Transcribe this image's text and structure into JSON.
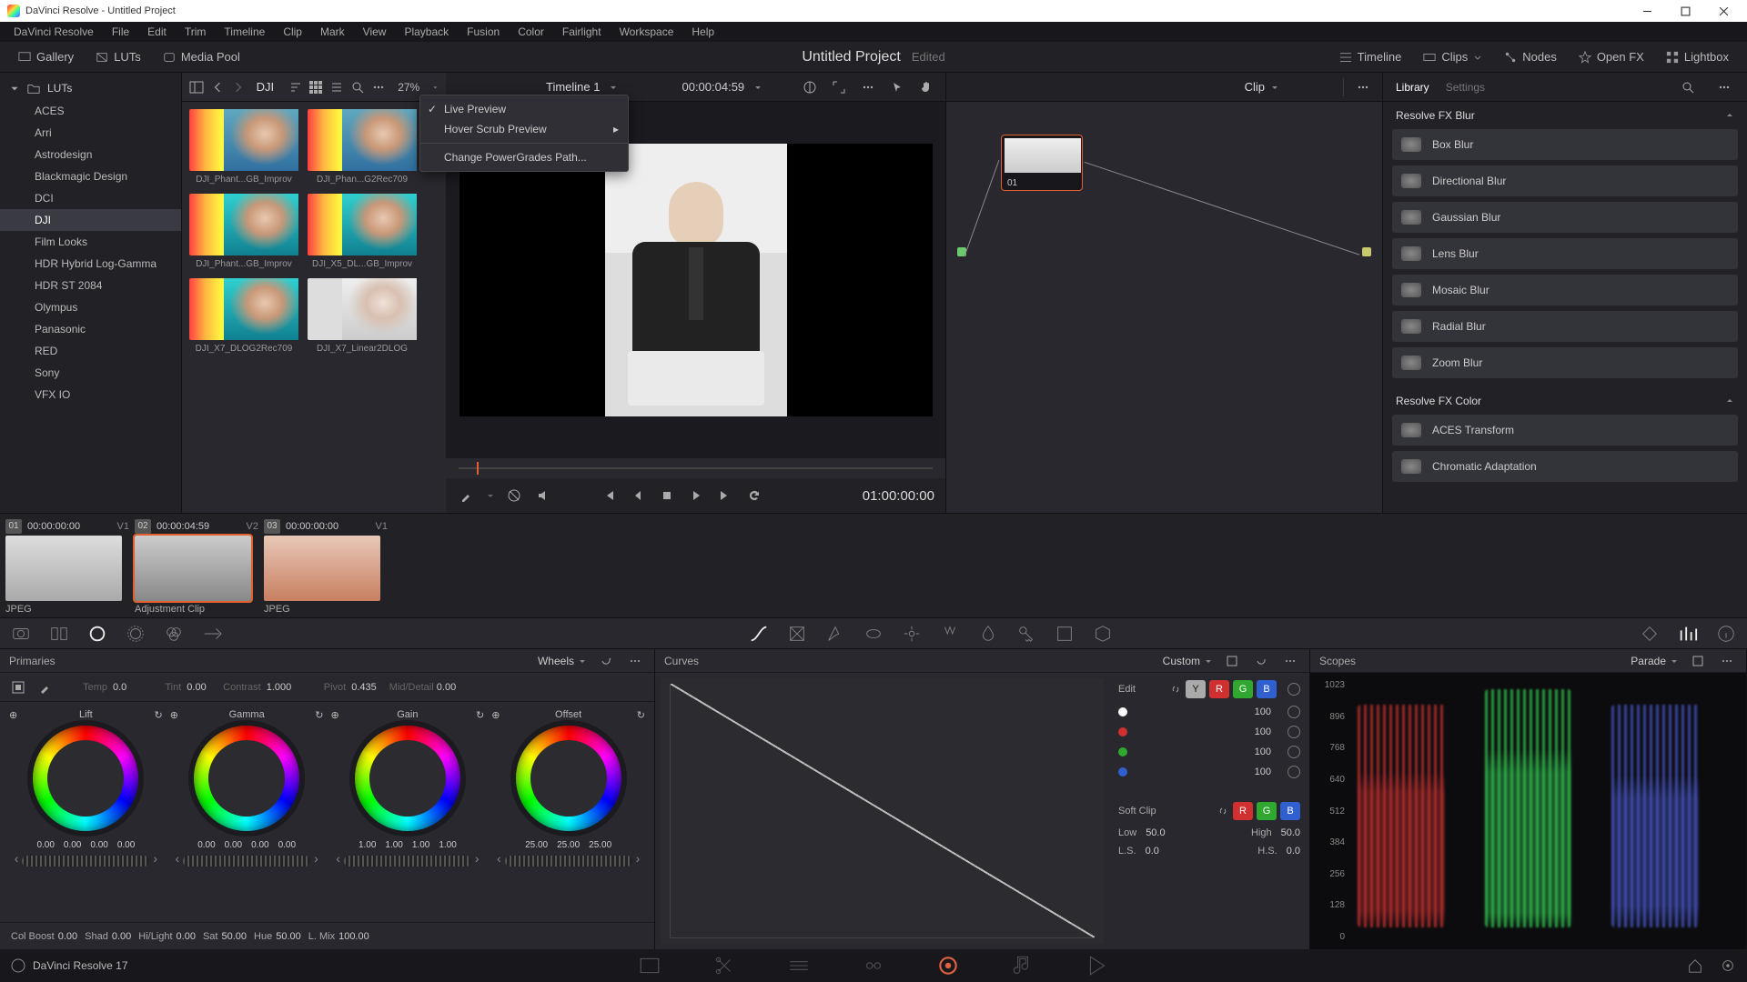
{
  "title": "DaVinci Resolve - Untitled Project",
  "menubar": [
    "DaVinci Resolve",
    "File",
    "Edit",
    "Trim",
    "Timeline",
    "Clip",
    "Mark",
    "View",
    "Playback",
    "Fusion",
    "Color",
    "Fairlight",
    "Workspace",
    "Help"
  ],
  "toolbar": {
    "gallery": "Gallery",
    "luts": "LUTs",
    "mediapool": "Media Pool",
    "timeline": "Timeline",
    "clips": "Clips",
    "nodes": "Nodes",
    "openfx": "Open FX",
    "lightbox": "Lightbox",
    "project": "Untitled Project",
    "edited": "Edited"
  },
  "luts_panel": {
    "root": "LUTs",
    "items": [
      "ACES",
      "Arri",
      "Astrodesign",
      "Blackmagic Design",
      "DCI",
      "DJI",
      "Film Looks",
      "HDR Hybrid Log-Gamma",
      "HDR ST 2084",
      "Olympus",
      "Panasonic",
      "RED",
      "Sony",
      "VFX IO"
    ],
    "selected": "DJI",
    "zoom": "27%",
    "grid": [
      {
        "label": "DJI_Phant...GB_Improv",
        "cls": ""
      },
      {
        "label": "DJI_Phan...G2Rec709",
        "cls": ""
      },
      {
        "label": "DJI_Phant...GB_Improv",
        "cls": "cyan"
      },
      {
        "label": "DJI_X5_DL...GB_Improv",
        "cls": "cyan"
      },
      {
        "label": "DJI_X7_DLOG2Rec709",
        "cls": "cyan"
      },
      {
        "label": "DJI_X7_Linear2DLOG",
        "cls": "pale"
      }
    ],
    "ctxmenu": {
      "live": "Live Preview",
      "hover": "Hover Scrub Preview",
      "change": "Change PowerGrades Path..."
    }
  },
  "viewer": {
    "timeline": "Timeline 1",
    "rec_tc": "00:00:04:59",
    "play_tc": "01:00:00:00"
  },
  "nodes": {
    "clip": "Clip",
    "id": "01"
  },
  "library": {
    "tabs": {
      "library": "Library",
      "settings": "Settings"
    },
    "blur_header": "Resolve FX Blur",
    "blur_items": [
      "Box Blur",
      "Directional Blur",
      "Gaussian Blur",
      "Lens Blur",
      "Mosaic Blur",
      "Radial Blur",
      "Zoom Blur"
    ],
    "color_header": "Resolve FX Color",
    "color_items": [
      "ACES Transform",
      "Chromatic Adaptation"
    ]
  },
  "clips": [
    {
      "n": "01",
      "tc": "00:00:00:00",
      "track": "V1",
      "label": "JPEG"
    },
    {
      "n": "02",
      "tc": "00:00:04:59",
      "track": "V2",
      "label": "Adjustment Clip"
    },
    {
      "n": "03",
      "tc": "00:00:00:00",
      "track": "V1",
      "label": "JPEG"
    }
  ],
  "primaries": {
    "title": "Primaries",
    "mode": "Wheels",
    "top": {
      "temp_l": "Temp",
      "temp_v": "0.0",
      "tint_l": "Tint",
      "tint_v": "0.00",
      "contrast_l": "Contrast",
      "contrast_v": "1.000",
      "pivot_l": "Pivot",
      "pivot_v": "0.435",
      "md_l": "Mid/Detail",
      "md_v": "0.00"
    },
    "wheels": [
      {
        "name": "Lift",
        "vals": [
          "0.00",
          "0.00",
          "0.00",
          "0.00"
        ]
      },
      {
        "name": "Gamma",
        "vals": [
          "0.00",
          "0.00",
          "0.00",
          "0.00"
        ]
      },
      {
        "name": "Gain",
        "vals": [
          "1.00",
          "1.00",
          "1.00",
          "1.00"
        ]
      },
      {
        "name": "Offset",
        "vals": [
          "25.00",
          "25.00",
          "25.00"
        ]
      }
    ],
    "bottom": {
      "colboost_l": "Col Boost",
      "colboost_v": "0.00",
      "shad_l": "Shad",
      "shad_v": "0.00",
      "hilight_l": "Hi/Light",
      "hilight_v": "0.00",
      "sat_l": "Sat",
      "sat_v": "50.00",
      "hue_l": "Hue",
      "hue_v": "50.00",
      "lmix_l": "L. Mix",
      "lmix_v": "100.00"
    }
  },
  "curves": {
    "title": "Curves",
    "mode": "Custom",
    "edit": "Edit",
    "vals": {
      "y": "100",
      "r": "100",
      "g": "100",
      "b": "100"
    },
    "soft": "Soft Clip",
    "low_l": "Low",
    "low_v": "50.0",
    "high_l": "High",
    "high_v": "50.0",
    "ls_l": "L.S.",
    "ls_v": "0.0",
    "hs_l": "H.S.",
    "hs_v": "0.0"
  },
  "scopes": {
    "title": "Scopes",
    "mode": "Parade",
    "scale": [
      "1023",
      "896",
      "768",
      "640",
      "512",
      "384",
      "256",
      "128",
      "0"
    ]
  },
  "footer": "DaVinci Resolve 17"
}
